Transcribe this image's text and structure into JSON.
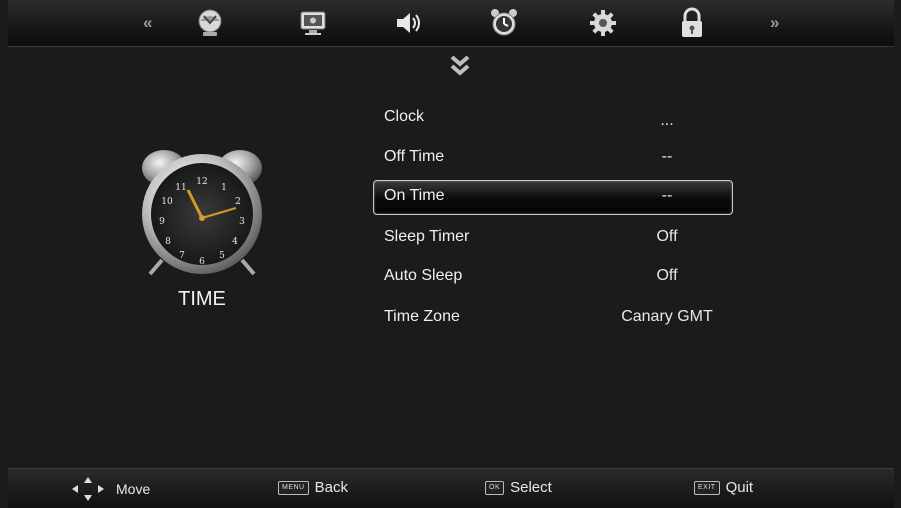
{
  "header": {
    "icons": [
      "prev-double-arrow-icon",
      "picture-mode-icon",
      "screen-settings-icon",
      "sound-icon",
      "alarm-clock-icon",
      "gear-icon",
      "lock-icon",
      "next-double-arrow-icon"
    ],
    "prev_glyph": "«",
    "next_glyph": "»"
  },
  "page": {
    "title": "TIME",
    "clock_numbers": [
      "12",
      "1",
      "2",
      "3",
      "4",
      "5",
      "6",
      "7",
      "8",
      "9",
      "10",
      "11"
    ]
  },
  "menu": {
    "items": [
      {
        "label": "Clock",
        "value": "..."
      },
      {
        "label": "Off Time",
        "value": "--"
      },
      {
        "label": "On Time",
        "value": "--"
      },
      {
        "label": "Sleep Timer",
        "value": "Off"
      },
      {
        "label": "Auto Sleep",
        "value": "Off"
      },
      {
        "label": "Time Zone",
        "value": "Canary GMT"
      }
    ],
    "selected_index": 2
  },
  "footer": {
    "move": {
      "label": "Move"
    },
    "back": {
      "key": "MENU",
      "label": "Back"
    },
    "select": {
      "key": "OK",
      "label": "Select"
    },
    "quit": {
      "key": "EXIT",
      "label": "Quit"
    }
  }
}
